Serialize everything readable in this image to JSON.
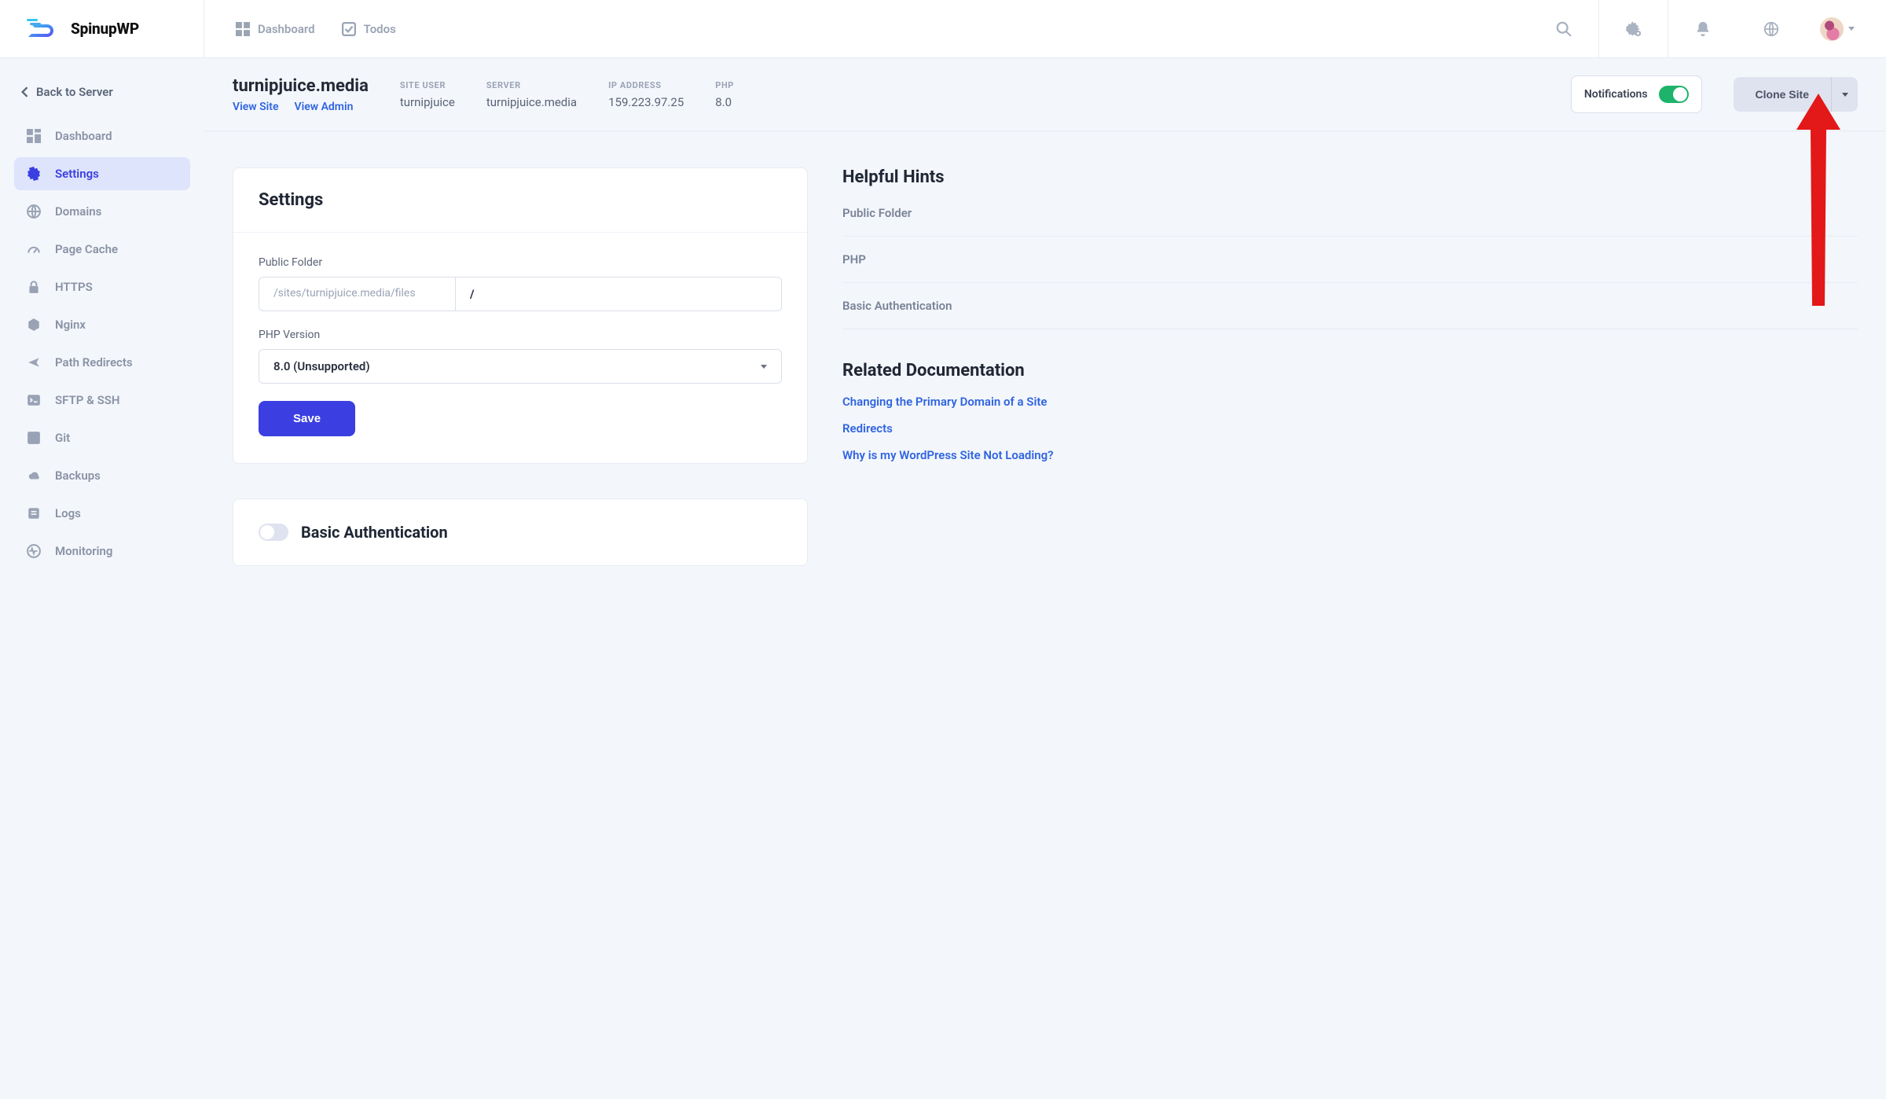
{
  "brand": {
    "name": "SpinupWP"
  },
  "header": {
    "nav": [
      {
        "id": "dashboard",
        "label": "Dashboard"
      },
      {
        "id": "todos",
        "label": "Todos"
      }
    ]
  },
  "sidebar": {
    "back_label": "Back to Server",
    "items": [
      {
        "id": "dashboard",
        "label": "Dashboard",
        "icon": "grid"
      },
      {
        "id": "settings",
        "label": "Settings",
        "icon": "gear",
        "active": true
      },
      {
        "id": "domains",
        "label": "Domains",
        "icon": "globe"
      },
      {
        "id": "page-cache",
        "label": "Page Cache",
        "icon": "gauge"
      },
      {
        "id": "https",
        "label": "HTTPS",
        "icon": "lock"
      },
      {
        "id": "nginx",
        "label": "Nginx",
        "icon": "hex"
      },
      {
        "id": "path-redirects",
        "label": "Path Redirects",
        "icon": "share"
      },
      {
        "id": "sftp-ssh",
        "label": "SFTP & SSH",
        "icon": "terminal"
      },
      {
        "id": "git",
        "label": "Git",
        "icon": "git"
      },
      {
        "id": "backups",
        "label": "Backups",
        "icon": "cloud"
      },
      {
        "id": "logs",
        "label": "Logs",
        "icon": "file"
      },
      {
        "id": "monitoring",
        "label": "Monitoring",
        "icon": "pulse"
      }
    ]
  },
  "site": {
    "domain": "turnipjuice.media",
    "view_site": "View Site",
    "view_admin": "View Admin",
    "meta": {
      "site_user_label": "SITE USER",
      "site_user": "turnipjuice",
      "server_label": "SERVER",
      "server": "turnipjuice.media",
      "ip_label": "IP ADDRESS",
      "ip": "159.223.97.25",
      "php_label": "PHP",
      "php": "8.0"
    },
    "notifications_label": "Notifications",
    "notifications_on": true,
    "clone_label": "Clone Site"
  },
  "settings_card": {
    "title": "Settings",
    "public_folder_label": "Public Folder",
    "public_folder_base": "/sites/turnipjuice.media/files",
    "public_folder_value": "/",
    "php_version_label": "PHP Version",
    "php_version_selected": "8.0 (Unsupported)",
    "save_label": "Save"
  },
  "auth_card": {
    "title": "Basic Authentication",
    "enabled": false
  },
  "hints": {
    "heading": "Helpful Hints",
    "items": [
      "Public Folder",
      "PHP",
      "Basic Authentication"
    ]
  },
  "docs": {
    "heading": "Related Documentation",
    "links": [
      "Changing the Primary Domain of a Site",
      "Redirects",
      "Why is my WordPress Site Not Loading?"
    ]
  }
}
